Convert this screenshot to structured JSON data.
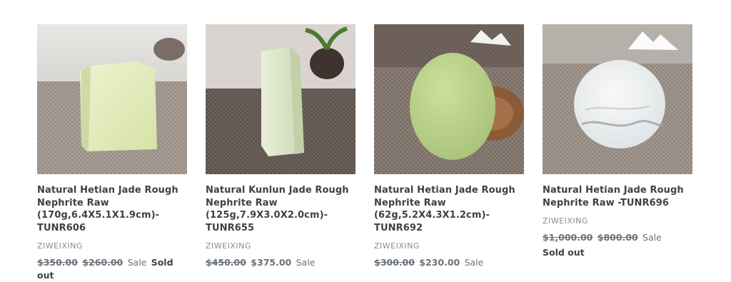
{
  "products": [
    {
      "title": "Natural Hetian Jade Rough\nNephrite Raw\n(170g,6.4X5.1X1.9cm)-\nTUNR606",
      "vendor": "ZIWEIXING",
      "compare_price": "$350.00",
      "price": "$260.00",
      "sale_label": "Sale",
      "sold_out": "Sold out"
    },
    {
      "title": "Natural Kunlun Jade Rough\nNephrite Raw\n(125g,7.9X3.0X2.0cm)-\nTUNR655",
      "vendor": "ZIWEIXING",
      "compare_price": "$450.00",
      "price": "$375.00",
      "sale_label": "Sale"
    },
    {
      "title": "Natural Hetian Jade Rough\nNephrite Raw\n(62g,5.2X4.3X1.2cm)-\nTUNR692",
      "vendor": "ZIWEIXING",
      "compare_price": "$300.00",
      "price": "$230.00",
      "sale_label": "Sale"
    },
    {
      "title": "Natural Hetian Jade Rough\nNephrite Raw -TUNR696",
      "vendor": "ZIWEIXING",
      "compare_price": "$1,000.00",
      "price": "$800.00",
      "sale_label": "Sale",
      "sold_out": "Sold out"
    }
  ]
}
